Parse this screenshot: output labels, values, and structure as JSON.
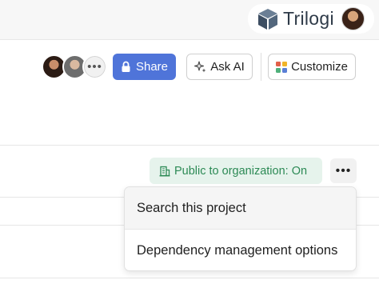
{
  "brand": {
    "name": "Trilogi",
    "icon": "cube-logo-icon"
  },
  "toolbar": {
    "more_label": "•••",
    "share_label": "Share",
    "ask_ai_label": "Ask AI",
    "customize_label": "Customize"
  },
  "project": {
    "visibility_label": "Public to organization: On",
    "more_label": "•••"
  },
  "menu": {
    "items": [
      {
        "label": "Search this project"
      },
      {
        "label": "Dependency management options"
      }
    ]
  },
  "colors": {
    "share_button": "#4f74d9",
    "badge_bg": "#e6f3ec",
    "badge_text": "#2c8a55"
  }
}
